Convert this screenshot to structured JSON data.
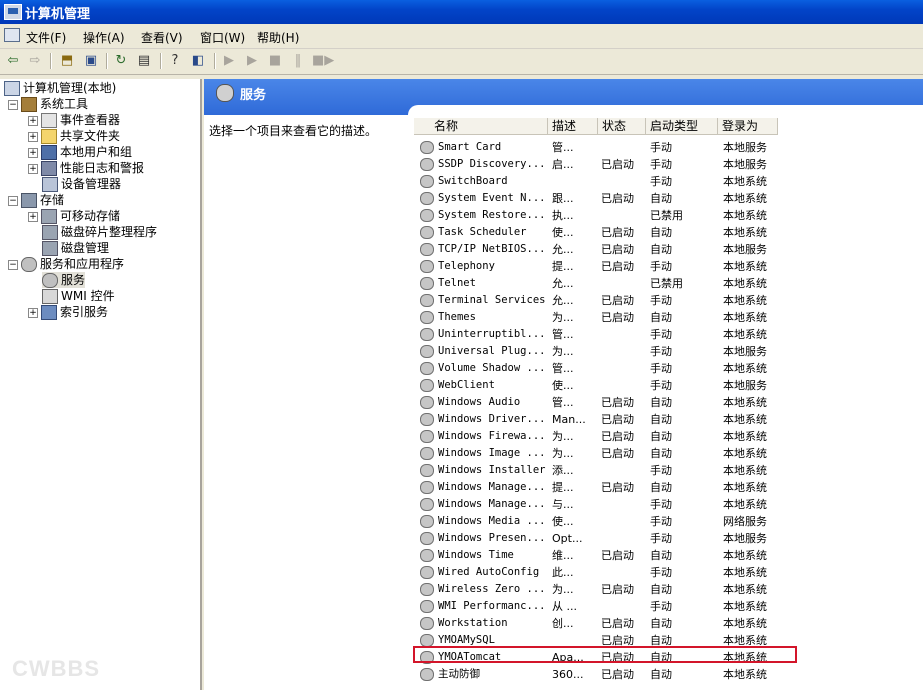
{
  "window": {
    "title": "计算机管理"
  },
  "menu": [
    "文件(F)",
    "操作(A)",
    "查看(V)",
    "窗口(W)",
    "帮助(H)"
  ],
  "toolbar_icons": [
    "back-arrow-icon",
    "forward-arrow-icon",
    "up-folder-icon",
    "show-tree-icon",
    "refresh-icon",
    "export-list-icon",
    "help-icon",
    "properties-icon",
    "start-service-icon",
    "start-service2-icon",
    "stop-service-icon",
    "pause-service-icon",
    "restart-service-icon"
  ],
  "tree": {
    "root": "计算机管理(本地)",
    "system_tools": "系统工具",
    "event_viewer": "事件查看器",
    "shared_folders": "共享文件夹",
    "local_users": "本地用户和组",
    "perf_logs": "性能日志和警报",
    "device_manager": "设备管理器",
    "storage": "存储",
    "removable": "可移动存储",
    "defrag": "磁盘碎片整理程序",
    "disk_mgmt": "磁盘管理",
    "services_apps": "服务和应用程序",
    "services": "服务",
    "wmi": "WMI 控件",
    "indexing": "索引服务"
  },
  "panel": {
    "title": "服务",
    "description": "选择一个项目来查看它的描述。"
  },
  "columns": {
    "name": "名称",
    "desc": "描述",
    "status": "状态",
    "startup": "启动类型",
    "logon": "登录为"
  },
  "services": [
    {
      "name": "Smart Card",
      "desc": "管...",
      "status": "",
      "startup": "手动",
      "logon": "本地服务"
    },
    {
      "name": "SSDP Discovery...",
      "desc": "启...",
      "status": "已启动",
      "startup": "手动",
      "logon": "本地服务"
    },
    {
      "name": "SwitchBoard",
      "desc": "",
      "status": "",
      "startup": "手动",
      "logon": "本地系统"
    },
    {
      "name": "System Event N...",
      "desc": "跟...",
      "status": "已启动",
      "startup": "自动",
      "logon": "本地系统"
    },
    {
      "name": "System Restore...",
      "desc": "执...",
      "status": "",
      "startup": "已禁用",
      "logon": "本地系统"
    },
    {
      "name": "Task Scheduler",
      "desc": "使...",
      "status": "已启动",
      "startup": "自动",
      "logon": "本地系统"
    },
    {
      "name": "TCP/IP NetBIOS...",
      "desc": "允...",
      "status": "已启动",
      "startup": "自动",
      "logon": "本地服务"
    },
    {
      "name": "Telephony",
      "desc": "提...",
      "status": "已启动",
      "startup": "手动",
      "logon": "本地系统"
    },
    {
      "name": "Telnet",
      "desc": "允...",
      "status": "",
      "startup": "已禁用",
      "logon": "本地系统"
    },
    {
      "name": "Terminal Services",
      "desc": "允...",
      "status": "已启动",
      "startup": "手动",
      "logon": "本地系统"
    },
    {
      "name": "Themes",
      "desc": "为...",
      "status": "已启动",
      "startup": "自动",
      "logon": "本地系统"
    },
    {
      "name": "Uninterruptibl...",
      "desc": "管...",
      "status": "",
      "startup": "手动",
      "logon": "本地系统"
    },
    {
      "name": "Universal Plug...",
      "desc": "为...",
      "status": "",
      "startup": "手动",
      "logon": "本地服务"
    },
    {
      "name": "Volume Shadow ...",
      "desc": "管...",
      "status": "",
      "startup": "手动",
      "logon": "本地系统"
    },
    {
      "name": "WebClient",
      "desc": "使...",
      "status": "",
      "startup": "手动",
      "logon": "本地服务"
    },
    {
      "name": "Windows Audio",
      "desc": "管...",
      "status": "已启动",
      "startup": "自动",
      "logon": "本地系统"
    },
    {
      "name": "Windows Driver...",
      "desc": "Man...",
      "status": "已启动",
      "startup": "自动",
      "logon": "本地系统"
    },
    {
      "name": "Windows Firewa...",
      "desc": "为...",
      "status": "已启动",
      "startup": "自动",
      "logon": "本地系统"
    },
    {
      "name": "Windows Image ...",
      "desc": "为...",
      "status": "已启动",
      "startup": "自动",
      "logon": "本地系统"
    },
    {
      "name": "Windows Installer",
      "desc": "添...",
      "status": "",
      "startup": "手动",
      "logon": "本地系统"
    },
    {
      "name": "Windows Manage...",
      "desc": "提...",
      "status": "已启动",
      "startup": "自动",
      "logon": "本地系统"
    },
    {
      "name": "Windows Manage...",
      "desc": "与...",
      "status": "",
      "startup": "手动",
      "logon": "本地系统"
    },
    {
      "name": "Windows Media ...",
      "desc": "使...",
      "status": "",
      "startup": "手动",
      "logon": "网络服务"
    },
    {
      "name": "Windows Presen...",
      "desc": "Opt...",
      "status": "",
      "startup": "手动",
      "logon": "本地服务"
    },
    {
      "name": "Windows Time",
      "desc": "维...",
      "status": "已启动",
      "startup": "自动",
      "logon": "本地系统"
    },
    {
      "name": "Wired AutoConfig",
      "desc": "此...",
      "status": "",
      "startup": "手动",
      "logon": "本地系统"
    },
    {
      "name": "Wireless Zero ...",
      "desc": "为...",
      "status": "已启动",
      "startup": "自动",
      "logon": "本地系统"
    },
    {
      "name": "WMI Performanc...",
      "desc": "从 ...",
      "status": "",
      "startup": "手动",
      "logon": "本地系统"
    },
    {
      "name": "Workstation",
      "desc": "创...",
      "status": "已启动",
      "startup": "自动",
      "logon": "本地系统"
    },
    {
      "name": "YMOAMySQL",
      "desc": "",
      "status": "已启动",
      "startup": "自动",
      "logon": "本地系统"
    },
    {
      "name": "YMOATomcat",
      "desc": "Apa...",
      "status": "已启动",
      "startup": "自动",
      "logon": "本地系统"
    },
    {
      "name": "主动防御",
      "desc": "360...",
      "status": "已启动",
      "startup": "自动",
      "logon": "本地系统"
    }
  ],
  "highlight_color": "#d3152a",
  "watermark": "CWBBS"
}
